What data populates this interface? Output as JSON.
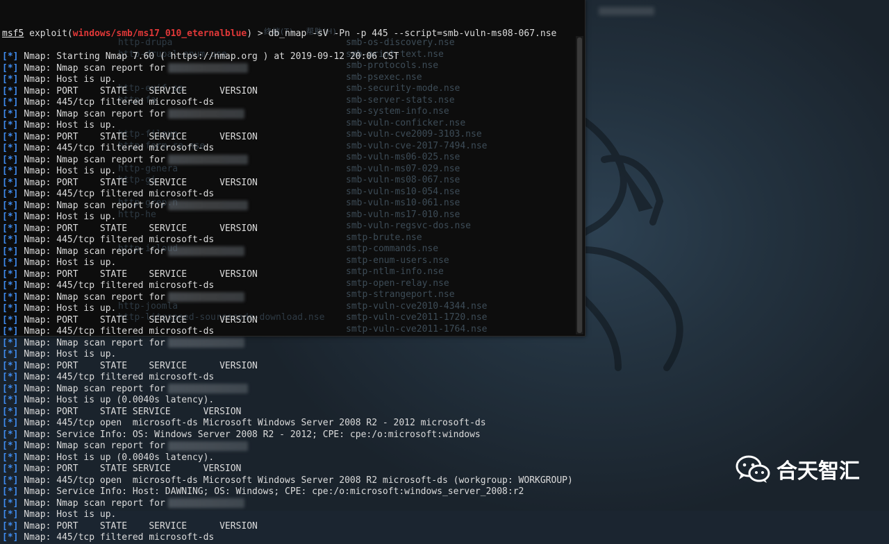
{
  "prompt": {
    "msf_tag": "msf5",
    "module_prefix": " exploit(",
    "module_path": "windows/smb/ms17_010_eternalblue",
    "module_suffix": ") > ",
    "command": "db_nmap -sV -Pn -p 445 --script=smb-vuln-ms08-067.nse"
  },
  "background_window": {
    "menu_labels": [
      "终端(T)",
      "帮助(H)"
    ],
    "files": [
      "smb-os-discovery.nse",
      "smb-print-text.nse",
      "smb-protocols.nse",
      "smb-psexec.nse",
      "smb-security-mode.nse",
      "smb-server-stats.nse",
      "smb-system-info.nse",
      "smb-vuln-conficker.nse",
      "smb-vuln-cve2009-3103.nse",
      "smb-vuln-cve-2017-7494.nse",
      "smb-vuln-ms06-025.nse",
      "smb-vuln-ms07-029.nse",
      "smb-vuln-ms08-067.nse",
      "smb-vuln-ms10-054.nse",
      "smb-vuln-ms10-061.nse",
      "smb-vuln-ms17-010.nse",
      "smb-vuln-regsvc-dos.nse",
      "smtp-brute.nse",
      "smtp-commands.nse",
      "smtp-enum-users.nse",
      "smtp-ntlm-info.nse",
      "smtp-open-relay.nse",
      "smtp-strangeport.nse",
      "smtp-vuln-cve2010-4344.nse",
      "smtp-vuln-cve2011-1720.nse",
      "smtp-vuln-cve2011-1764.nse"
    ],
    "ghost_files": [
      "http-drupa",
      "http-drupal-enum-use",
      "",
      "",
      "http-exif-sp",
      "http-fa",
      "",
      "",
      "http-fileup",
      "http-form-re.nse",
      "",
      "http-genera",
      "http-gi",
      "",
      "http-grep.n",
      "http-he",
      "",
      "",
      "http-icloud",
      "",
      "",
      "",
      "",
      "http-joomla",
      "http-litespeed-sourcecode-download.nse"
    ]
  },
  "terminal": {
    "lines": [
      {
        "p": "[",
        "s": "*",
        "q": "]",
        "t": " Nmap: Starting Nmap 7.60 ( https://nmap.org ) at 2019-09-12 20:06 CST",
        "b": 0
      },
      {
        "p": "[",
        "s": "*",
        "q": "]",
        "t": " Nmap: Nmap scan report for",
        "b": 115
      },
      {
        "p": "[",
        "s": "*",
        "q": "]",
        "t": " Nmap: Host is up.",
        "b": 0
      },
      {
        "p": "[",
        "s": "*",
        "q": "]",
        "t": " Nmap: PORT    STATE    SERVICE      VERSION",
        "b": 0
      },
      {
        "p": "[",
        "s": "*",
        "q": "]",
        "t": " Nmap: 445/tcp filtered microsoft-ds",
        "b": 0
      },
      {
        "p": "[",
        "s": "*",
        "q": "]",
        "t": " Nmap: Nmap scan report for",
        "b": 110
      },
      {
        "p": "[",
        "s": "*",
        "q": "]",
        "t": " Nmap: Host is up.",
        "b": 0
      },
      {
        "p": "[",
        "s": "*",
        "q": "]",
        "t": " Nmap: PORT    STATE    SERVICE      VERSION",
        "b": 0
      },
      {
        "p": "[",
        "s": "*",
        "q": "]",
        "t": " Nmap: 445/tcp filtered microsoft-ds",
        "b": 0
      },
      {
        "p": "[",
        "s": "*",
        "q": "]",
        "t": " Nmap: Nmap scan report for",
        "b": 115
      },
      {
        "p": "[",
        "s": "*",
        "q": "]",
        "t": " Nmap: Host is up.",
        "b": 0
      },
      {
        "p": "[",
        "s": "*",
        "q": "]",
        "t": " Nmap: PORT    STATE    SERVICE      VERSION",
        "b": 0
      },
      {
        "p": "[",
        "s": "*",
        "q": "]",
        "t": " Nmap: 445/tcp filtered microsoft-ds",
        "b": 0
      },
      {
        "p": "[",
        "s": "*",
        "q": "]",
        "t": " Nmap: Nmap scan report for",
        "b": 115
      },
      {
        "p": "[",
        "s": "*",
        "q": "]",
        "t": " Nmap: Host is up.",
        "b": 0
      },
      {
        "p": "[",
        "s": "*",
        "q": "]",
        "t": " Nmap: PORT    STATE    SERVICE      VERSION",
        "b": 0
      },
      {
        "p": "[",
        "s": "*",
        "q": "]",
        "t": " Nmap: 445/tcp filtered microsoft-ds",
        "b": 0
      },
      {
        "p": "[",
        "s": "*",
        "q": "]",
        "t": " Nmap: Nmap scan report for",
        "b": 110
      },
      {
        "p": "[",
        "s": "*",
        "q": "]",
        "t": " Nmap: Host is up.",
        "b": 0
      },
      {
        "p": "[",
        "s": "*",
        "q": "]",
        "t": " Nmap: PORT    STATE    SERVICE      VERSION",
        "b": 0
      },
      {
        "p": "[",
        "s": "*",
        "q": "]",
        "t": " Nmap: 445/tcp filtered microsoft-ds",
        "b": 0
      },
      {
        "p": "[",
        "s": "*",
        "q": "]",
        "t": " Nmap: Nmap scan report for",
        "b": 110
      },
      {
        "p": "[",
        "s": "*",
        "q": "]",
        "t": " Nmap: Host is up.",
        "b": 0
      },
      {
        "p": "[",
        "s": "*",
        "q": "]",
        "t": " Nmap: PORT    STATE    SERVICE      VERSION",
        "b": 0
      },
      {
        "p": "[",
        "s": "*",
        "q": "]",
        "t": " Nmap: 445/tcp filtered microsoft-ds",
        "b": 0
      },
      {
        "p": "[",
        "s": "*",
        "q": "]",
        "t": " Nmap: Nmap scan report for",
        "b": 110
      },
      {
        "p": "[",
        "s": "*",
        "q": "]",
        "t": " Nmap: Host is up.",
        "b": 0
      },
      {
        "p": "[",
        "s": "*",
        "q": "]",
        "t": " Nmap: PORT    STATE    SERVICE      VERSION",
        "b": 0
      },
      {
        "p": "[",
        "s": "*",
        "q": "]",
        "t": " Nmap: 445/tcp filtered microsoft-ds",
        "b": 0
      },
      {
        "p": "[",
        "s": "*",
        "q": "]",
        "t": " Nmap: Nmap scan report for",
        "b": 115
      },
      {
        "p": "[",
        "s": "*",
        "q": "]",
        "t": " Nmap: Host is up (0.0040s latency).",
        "b": 0
      },
      {
        "p": "[",
        "s": "*",
        "q": "]",
        "t": " Nmap: PORT    STATE SERVICE      VERSION",
        "b": 0
      },
      {
        "p": "[",
        "s": "*",
        "q": "]",
        "t": " Nmap: 445/tcp open  microsoft-ds Microsoft Windows Server 2008 R2 - 2012 microsoft-ds",
        "b": 0
      },
      {
        "p": "[",
        "s": "*",
        "q": "]",
        "t": " Nmap: Service Info: OS: Windows Server 2008 R2 - 2012; CPE: cpe:/o:microsoft:windows",
        "b": 0
      },
      {
        "p": "[",
        "s": "*",
        "q": "]",
        "t": " Nmap: Nmap scan report for",
        "b": 115
      },
      {
        "p": "[",
        "s": "*",
        "q": "]",
        "t": " Nmap: Host is up (0.0040s latency).",
        "b": 0
      },
      {
        "p": "[",
        "s": "*",
        "q": "]",
        "t": " Nmap: PORT    STATE SERVICE      VERSION",
        "b": 0
      },
      {
        "p": "[",
        "s": "*",
        "q": "]",
        "t": " Nmap: 445/tcp open  microsoft-ds Microsoft Windows Server 2008 R2 microsoft-ds (workgroup: WORKGROUP)",
        "b": 0
      },
      {
        "p": "[",
        "s": "*",
        "q": "]",
        "t": " Nmap: Service Info: Host: DAWNING; OS: Windows; CPE: cpe:/o:microsoft:windows_server_2008:r2",
        "b": 0
      },
      {
        "p": "[",
        "s": "*",
        "q": "]",
        "t": " Nmap: Nmap scan report for",
        "b": 110
      },
      {
        "p": "[",
        "s": "*",
        "q": "]",
        "t": " Nmap: Host is up.",
        "b": 0
      },
      {
        "p": "[",
        "s": "*",
        "q": "]",
        "t": " Nmap: PORT    STATE    SERVICE      VERSION",
        "b": 0
      },
      {
        "p": "[",
        "s": "*",
        "q": "]",
        "t": " Nmap: 445/tcp filtered microsoft-ds",
        "b": 0
      }
    ]
  },
  "watermark": {
    "text": "合天智汇",
    "icon": "wechat-icon"
  }
}
